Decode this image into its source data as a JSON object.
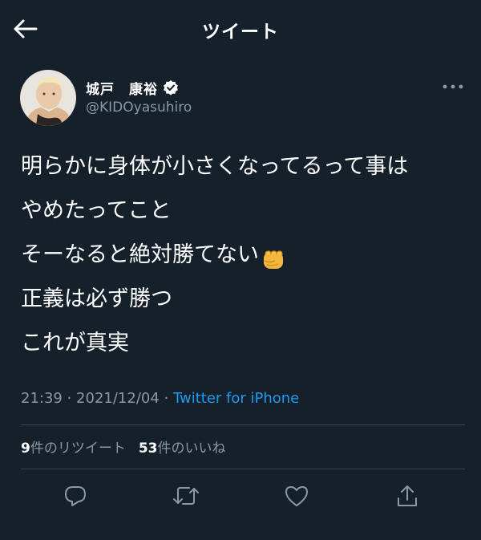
{
  "header": {
    "title": "ツイート",
    "back_icon": "arrow-left-icon"
  },
  "author": {
    "name": "城戸　康裕",
    "handle": "@KIDOyasuhiro",
    "verified": true,
    "avatar_icon": "avatar-photo"
  },
  "tweet": {
    "lines": [
      "明らかに身体が小さくなってるって事は",
      "やめたってこと",
      "そーなると絶対勝てない",
      "正義は必ず勝つ",
      "これが真実"
    ],
    "emoji": "oncoming-fist-icon"
  },
  "meta": {
    "time": "21:39",
    "separator": " · ",
    "date": "2021/12/04",
    "source": "Twitter for iPhone"
  },
  "stats": {
    "retweets_count": "9",
    "retweets_label": "件のリツイート",
    "likes_count": "53",
    "likes_label": "件のいいね"
  },
  "actions": {
    "reply_icon": "reply-icon",
    "retweet_icon": "retweet-icon",
    "like_icon": "heart-icon",
    "share_icon": "share-icon"
  },
  "colors": {
    "background": "#15202b",
    "text": "#ffffff",
    "secondary": "#8b98a5",
    "link": "#1d9bf0",
    "divider": "#38444d"
  }
}
